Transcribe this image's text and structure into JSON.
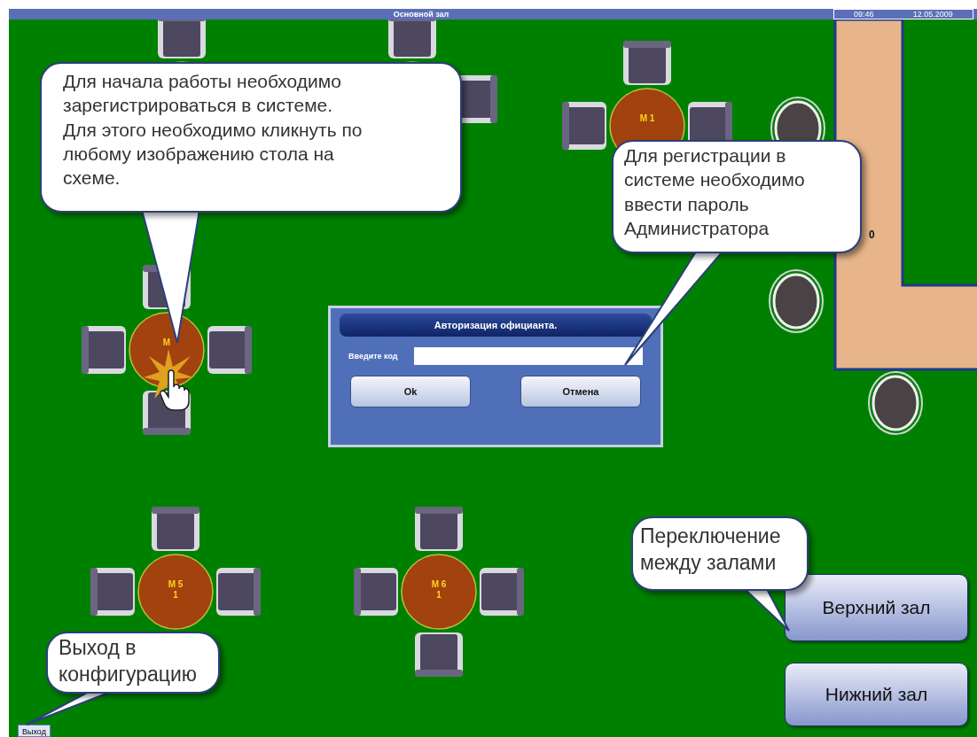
{
  "title_bar": {
    "title": "Основной зал",
    "time": "09:46",
    "date": "12.05.2009"
  },
  "tables": [
    {
      "lines": [
        "М 1"
      ]
    },
    {
      "lines": [
        "М"
      ]
    },
    {
      "lines": [
        "М 5",
        "1"
      ]
    },
    {
      "lines": [
        "М 6",
        "1"
      ]
    }
  ],
  "bar": {
    "label": "0"
  },
  "dialog": {
    "title": "Авторизация официанта.",
    "field_label": "Введите код",
    "buttons": [
      "Ok",
      "Отмена"
    ]
  },
  "hall_buttons": [
    "Верхний зал",
    "Нижний зал"
  ],
  "exit_button": "Выход",
  "callouts": [
    {
      "text": "Для начала работы необходимо\nзарегистрироваться в системе.\nДля этого необходимо кликнуть по\nлюбому изображению стола на\nсхеме."
    },
    {
      "text": "Для регистрации в\nсистеме необходимо\nввести пароль\nАдминистратора"
    },
    {
      "text": "Переключение\nмежду залами"
    },
    {
      "text": "Выход в\nконфигурацию"
    }
  ]
}
